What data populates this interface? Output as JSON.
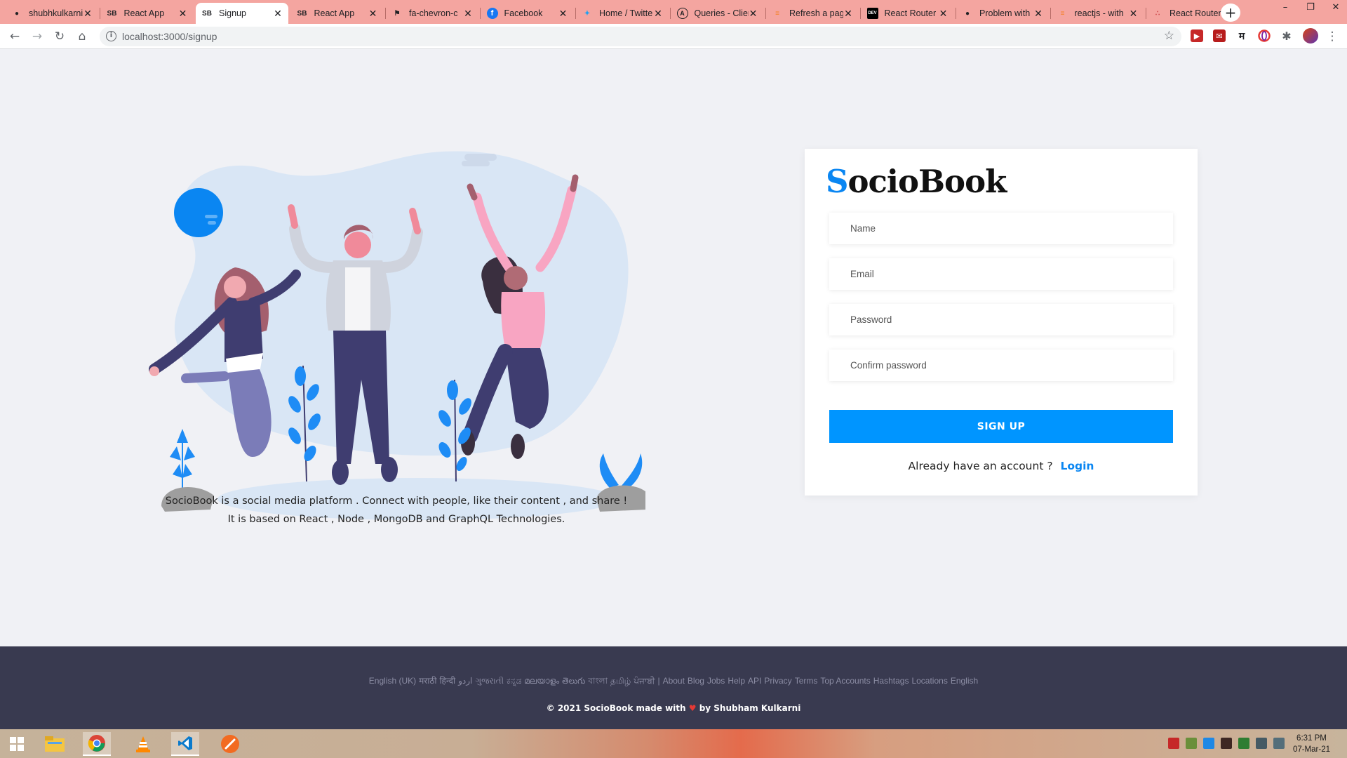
{
  "browser": {
    "tabs": [
      {
        "title": "shubhkulkarni",
        "icon": "github-icon"
      },
      {
        "title": "React App",
        "icon": "sb-logo-icon"
      },
      {
        "title": "Signup",
        "icon": "sb-logo-icon",
        "active": true
      },
      {
        "title": "React App",
        "icon": "sb-logo-icon"
      },
      {
        "title": "fa-chevron-c",
        "icon": "fontawesome-icon"
      },
      {
        "title": "Facebook",
        "icon": "facebook-icon"
      },
      {
        "title": "Home / Twitter",
        "icon": "twitter-icon"
      },
      {
        "title": "Queries - Client",
        "icon": "apollo-icon"
      },
      {
        "title": "Refresh a page",
        "icon": "stackoverflow-icon"
      },
      {
        "title": "React Router",
        "icon": "dev-icon"
      },
      {
        "title": "Problem with",
        "icon": "github-icon"
      },
      {
        "title": "reactjs - with",
        "icon": "stackoverflow-icon"
      },
      {
        "title": "React Router",
        "icon": "react-router-icon"
      }
    ],
    "favicon_text": {
      "sb": "SB",
      "dev": "DEV"
    },
    "new_tab_label": "+",
    "window_controls": {
      "minimize": "–",
      "restore": "❐",
      "close": "✕"
    },
    "address": "localhost:3000/signup",
    "extension_marathi": "म"
  },
  "illustration": {
    "colors": {
      "blob": "#d9e6f5",
      "sun": "#0a86f2",
      "plant": "#1e8cf5",
      "rock": "#9e9e9e"
    }
  },
  "main": {
    "description_line1": "SocioBook is a social media platform . Connect with people, like their content , and share !",
    "description_line2": "It is based on React , Node , MongoDB and GraphQL Technologies."
  },
  "signup": {
    "logo_first": "S",
    "logo_rest": "ocioBook",
    "name_placeholder": "Name",
    "email_placeholder": "Email",
    "password_placeholder": "Password",
    "confirm_placeholder": "Confirm password",
    "button_label": "SIGN UP",
    "account_prompt": "Already have an account ?",
    "login_link": "Login",
    "accent_color": "#0095ff"
  },
  "footer": {
    "links": [
      "English (UK)",
      "मराठी",
      "हिन्दी",
      "اردو",
      "ગુજરાતી",
      "ಕನ್ನಡ",
      "മലയാളം",
      "తెలుగు",
      "বাংলা",
      "தமிழ்",
      "ਪੰਜਾਬੀ",
      "|",
      "About",
      "Blog",
      "Jobs",
      "Help",
      "API",
      "Privacy",
      "Terms",
      "Top Accounts",
      "Hashtags",
      "Locations",
      "English"
    ],
    "copyright_prefix": "© 2021 SocioBook made with",
    "heart": "♥",
    "copyright_suffix": "by Shubham Kulkarni",
    "background": "#393a50"
  },
  "taskbar": {
    "time": "6:31 PM",
    "date": "07-Mar-21"
  }
}
